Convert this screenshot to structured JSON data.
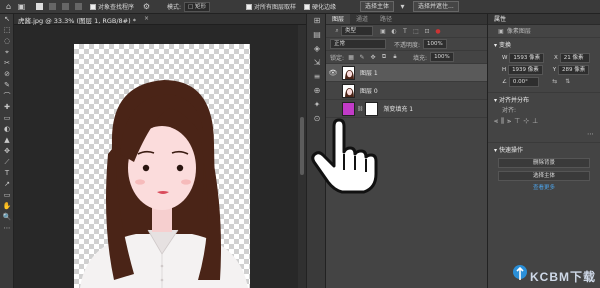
{
  "options_bar": {
    "auto_select_label": "对象查找程序",
    "mode_label": "模式:",
    "mode_value": "□ 矩形",
    "sample_all_label": "对所有图层取样",
    "enhance_edge_label": "硬化边缘",
    "select_subject_button": "选择主体",
    "select_and_mask_button": "选择并遮住..."
  },
  "document": {
    "tab_title": "虎酱.jpg @ 33.3% (图层 1, RGB/8#) *",
    "close_glyph": "×"
  },
  "tools": [
    "↖",
    "⬚",
    "◌",
    "⌖",
    "✂",
    "⊘",
    "✎",
    "⌒",
    "✚",
    "▭",
    "◐",
    "▲",
    "✥",
    "⟋",
    "T",
    "↗",
    "▭",
    "✋",
    "🔍",
    "⋯"
  ],
  "strip_icons": [
    "⊞",
    "▤",
    "◈",
    "⇲",
    "≡",
    "⊕",
    "✦",
    "⊙"
  ],
  "layers_panel": {
    "tabs": [
      "图层",
      "通道",
      "路径"
    ],
    "filter_label": "类型",
    "blend_mode": "正常",
    "opacity_label": "不透明度:",
    "opacity_value": "100%",
    "lock_label": "锁定:",
    "fill_label": "填充:",
    "fill_value": "100%",
    "layers": [
      {
        "name": "图层 1",
        "active": true
      },
      {
        "name": "图层 0",
        "active": false
      },
      {
        "name": "渐变填充 1",
        "active": false
      }
    ]
  },
  "properties_panel": {
    "title": "属性",
    "subtitle": "像素图层",
    "transform_title": "变换",
    "w_label": "W",
    "w_value": "1593 像素",
    "x_label": "X",
    "x_value": "21 像素",
    "h_label": "H",
    "h_value": "1939 像素",
    "y_label": "Y",
    "y_value": "289 像素",
    "angle_value": "0.00°",
    "align_title": "对齐并分布",
    "align_label": "对齐:",
    "quick_actions_title": "快速操作",
    "remove_bg_button": "删除背景",
    "select_subject_button": "选择主体",
    "view_more_link": "查看更多"
  },
  "watermark": {
    "text": "KCBM下载"
  },
  "colors": {
    "accent": "#2a8fd8",
    "gradient_fill": "#c23bc8"
  }
}
